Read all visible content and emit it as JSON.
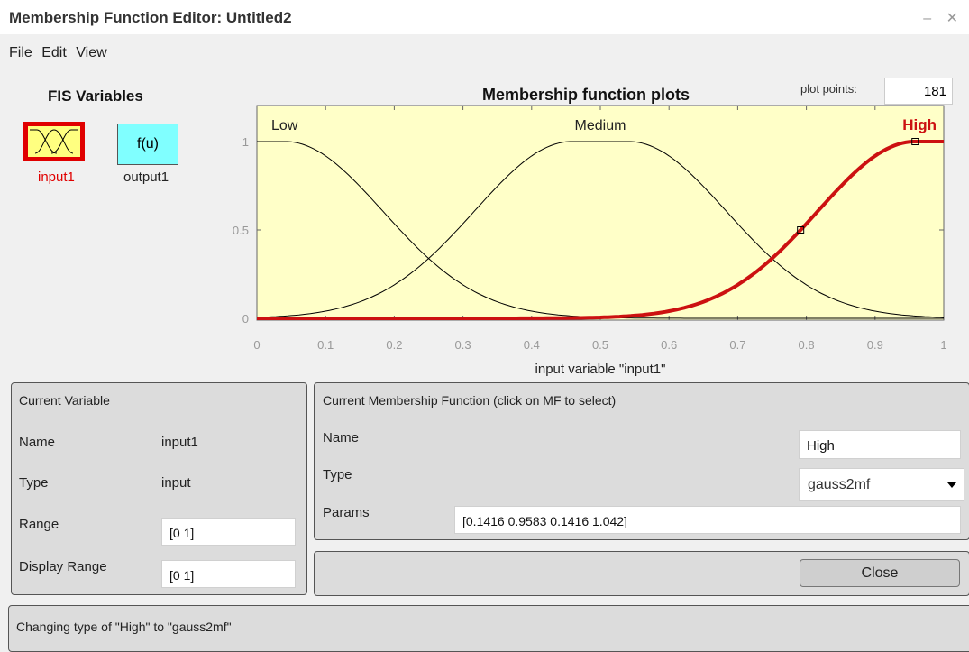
{
  "window": {
    "title": "Membership Function Editor: Untitled2",
    "controls": "– ✕"
  },
  "menu": [
    "File",
    "Edit",
    "View"
  ],
  "fis_variables": {
    "title": "FIS Variables",
    "input": {
      "label": "input1",
      "icon": "gaussian-mf-icon",
      "selected": true
    },
    "output": {
      "label": "output1",
      "icon_text": "f(u)"
    }
  },
  "plot": {
    "title": "Membership function plots",
    "plot_points_label": "plot points:",
    "plot_points_value": "181",
    "xlabel": "input variable \"input1\"",
    "selected_color": "#cc1111",
    "background": "#ffffc8"
  },
  "chart_data": {
    "type": "line",
    "xlim": [
      0,
      1
    ],
    "ylim": [
      0,
      1
    ],
    "xticks": [
      "0",
      "0.1",
      "0.2",
      "0.3",
      "0.4",
      "0.5",
      "0.6",
      "0.7",
      "0.8",
      "0.9",
      "1"
    ],
    "yticks": [
      "0",
      "0.5",
      "1"
    ],
    "series": [
      {
        "name": "Low",
        "mf": "gauss2mf",
        "params": [
          0.1416,
          -0.042,
          0.1416,
          0.0417
        ],
        "selected": false
      },
      {
        "name": "Medium",
        "mf": "gauss2mf",
        "params": [
          0.1416,
          0.4583,
          0.1416,
          0.5417
        ],
        "selected": false
      },
      {
        "name": "High",
        "mf": "gauss2mf",
        "params": [
          0.1416,
          0.9583,
          0.1416,
          1.042
        ],
        "selected": true
      }
    ]
  },
  "current_variable": {
    "title": "Current Variable",
    "name_label": "Name",
    "name_value": "input1",
    "type_label": "Type",
    "type_value": "input",
    "range_label": "Range",
    "range_value": "[0 1]",
    "display_range_label": "Display Range",
    "display_range_value": "[0 1]"
  },
  "current_mf": {
    "title": "Current Membership Function (click on MF to select)",
    "name_label": "Name",
    "name_value": "High",
    "type_label": "Type",
    "type_value": "gauss2mf",
    "params_label": "Params",
    "params_value": "[0.1416 0.9583 0.1416 1.042]"
  },
  "close_label": "Close",
  "status": "Changing type of \"High\" to \"gauss2mf\""
}
